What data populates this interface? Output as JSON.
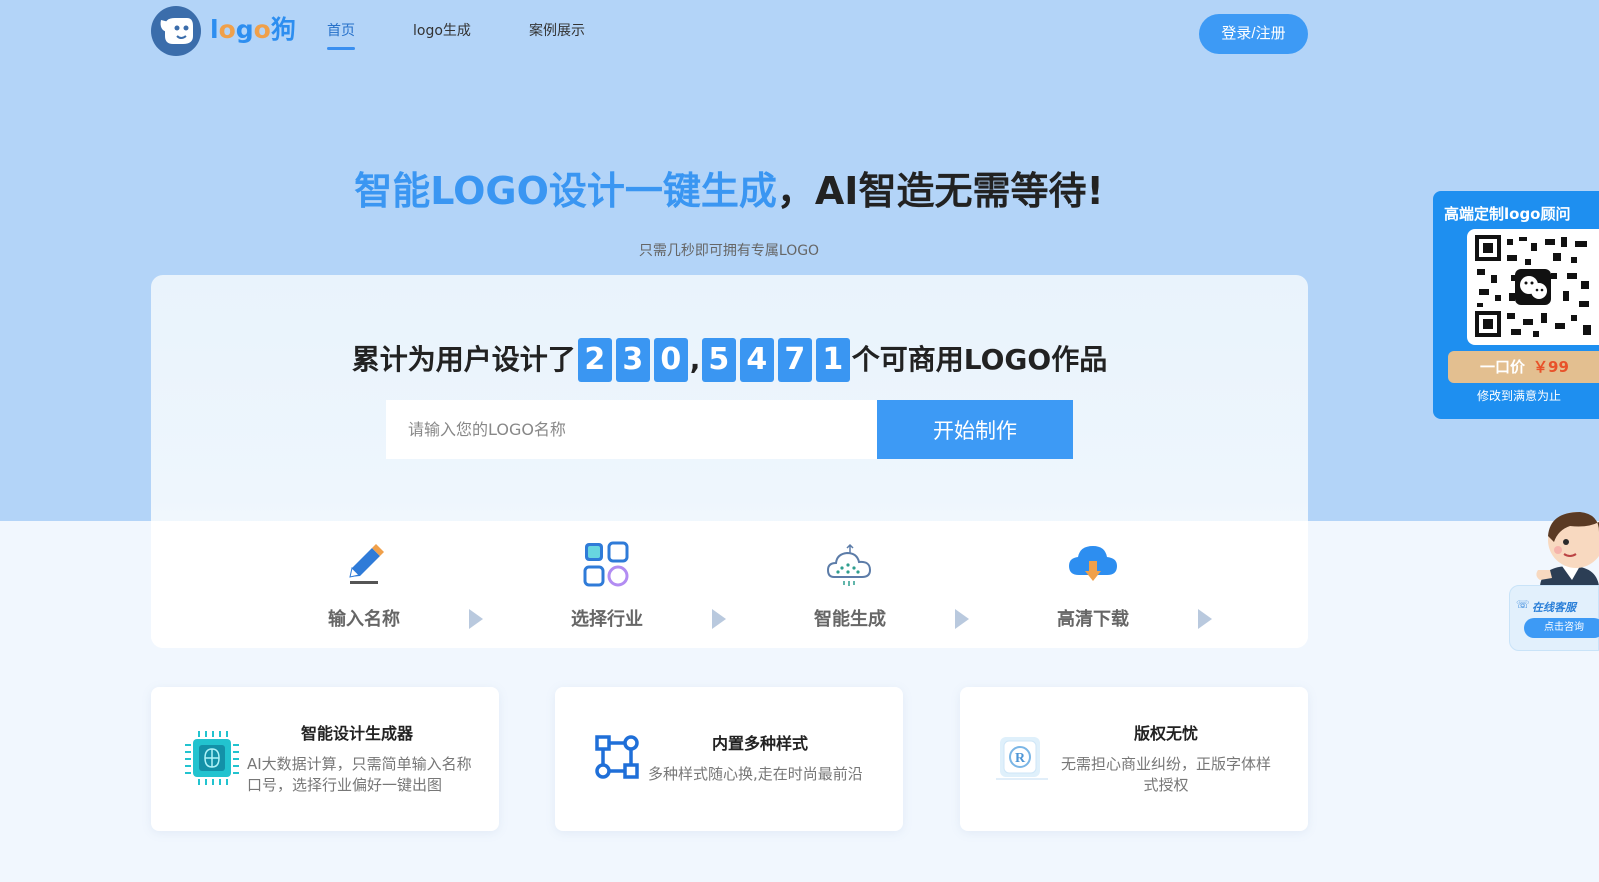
{
  "header": {
    "logo_text_a": "l",
    "logo_text_b": "o",
    "logo_text_c": "g",
    "logo_text_d": "o",
    "logo_text_e": "狗",
    "nav": [
      "首页",
      "logo生成",
      "案例展示"
    ],
    "login_label": "登录/注册"
  },
  "hero": {
    "headline_highlight": "智能LOGO设计一键生成",
    "headline_rest": "，AI智造无需等待!",
    "subheadline": "只需几秒即可拥有专属LOGO"
  },
  "counter": {
    "prefix": "累计为用户设计了",
    "digits": [
      "2",
      "3",
      "0",
      "5",
      "4",
      "7",
      "1"
    ],
    "separator": ",",
    "suffix": "个可商用LOGO作品"
  },
  "search": {
    "placeholder": "请输入您的LOGO名称",
    "button_label": "开始制作"
  },
  "steps": [
    "输入名称",
    "选择行业",
    "智能生成",
    "高清下载"
  ],
  "features": [
    {
      "title": "智能设计生成器",
      "desc": "AI大数据计算，只需简单输入名称口号，选择行业偏好一键出图"
    },
    {
      "title": "内置多种样式",
      "desc": "多种样式随心换,走在时尚最前沿"
    },
    {
      "title": "版权无忧",
      "desc": "无需担心商业纠纷，正版字体样式授权"
    }
  ],
  "float_panel": {
    "title": "高端定制logo顾问",
    "price_label": "一口价",
    "price_value": "￥99",
    "note": "修改到满意为止"
  },
  "customer_service": {
    "title": "在线客服",
    "button_label": "点击咨询"
  },
  "colors": {
    "accent": "#3d9af5",
    "hero_bg": "#b3d4f8",
    "price_bg": "#e3bf90",
    "price_text": "#e8522a"
  }
}
